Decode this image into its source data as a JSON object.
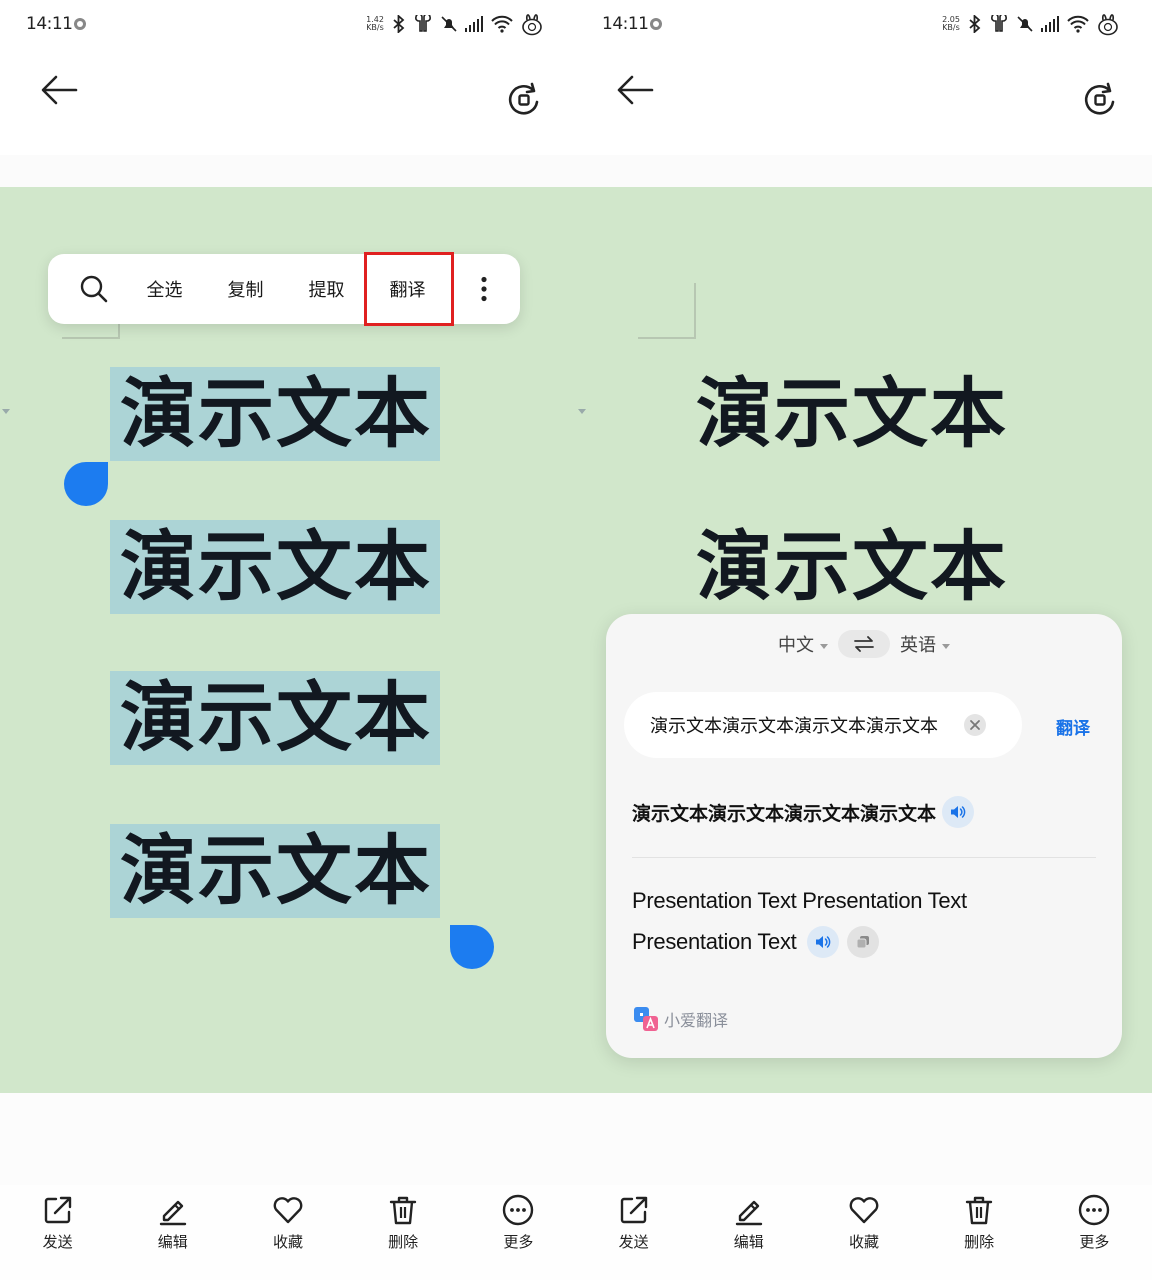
{
  "screens": [
    {
      "status_bar": {
        "time": "14:11",
        "net_speed_value": "1.42",
        "net_speed_unit": "KB/s"
      },
      "demo_text": [
        "演示文本",
        "演示文本",
        "演示文本",
        "演示文本"
      ],
      "selection_toolbar": {
        "items": [
          {
            "label": "全选",
            "highlighted": false
          },
          {
            "label": "复制",
            "highlighted": false
          },
          {
            "label": "提取",
            "highlighted": false
          },
          {
            "label": "翻译",
            "highlighted": true
          }
        ],
        "highlight_color": "#e02020"
      },
      "bottom_bar": [
        {
          "label": "发送",
          "icon": "share-icon"
        },
        {
          "label": "编辑",
          "icon": "edit-icon"
        },
        {
          "label": "收藏",
          "icon": "heart-icon"
        },
        {
          "label": "删除",
          "icon": "trash-icon"
        },
        {
          "label": "更多",
          "icon": "more-icon"
        }
      ]
    },
    {
      "status_bar": {
        "time": "14:11",
        "net_speed_value": "2.05",
        "net_speed_unit": "KB/s"
      },
      "demo_text": [
        "演示文本",
        "演示文本"
      ],
      "translate_panel": {
        "source_lang": "中文",
        "target_lang": "英语",
        "input_text": "演示文本演示文本演示文本演示文本",
        "translate_button": "翻译",
        "source_text": "演示文本演示文本演示文本演示文本",
        "result_line1": "Presentation Text Presentation Text",
        "result_line2": "Presentation Text",
        "brand": "小爱翻译"
      },
      "bottom_bar": [
        {
          "label": "发送",
          "icon": "share-icon"
        },
        {
          "label": "编辑",
          "icon": "edit-icon"
        },
        {
          "label": "收藏",
          "icon": "heart-icon"
        },
        {
          "label": "删除",
          "icon": "trash-icon"
        },
        {
          "label": "更多",
          "icon": "more-icon"
        }
      ]
    }
  ],
  "colors": {
    "image_background": "#d1e7cb",
    "selection_highlight": "#acd4d6",
    "selection_handle": "#1c7cf0",
    "accent_blue": "#1a73e8"
  }
}
